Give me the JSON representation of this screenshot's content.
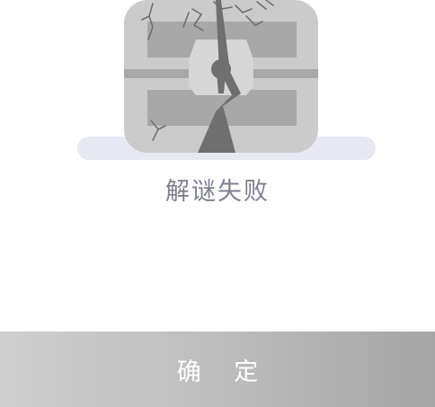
{
  "dialog": {
    "illustration_icon": "broken-treasure-chest-icon",
    "message": "解谜失败",
    "confirm_label": "确 定"
  },
  "colors": {
    "message_text": "#7c8090",
    "button_gradient_start": "#cfcfcf",
    "button_gradient_end": "#a5a5a5",
    "button_text": "#ffffff",
    "chest_body": "#cbcbcb",
    "chest_bands": "#a8a8a8",
    "shadow": "#e6e8f2"
  }
}
